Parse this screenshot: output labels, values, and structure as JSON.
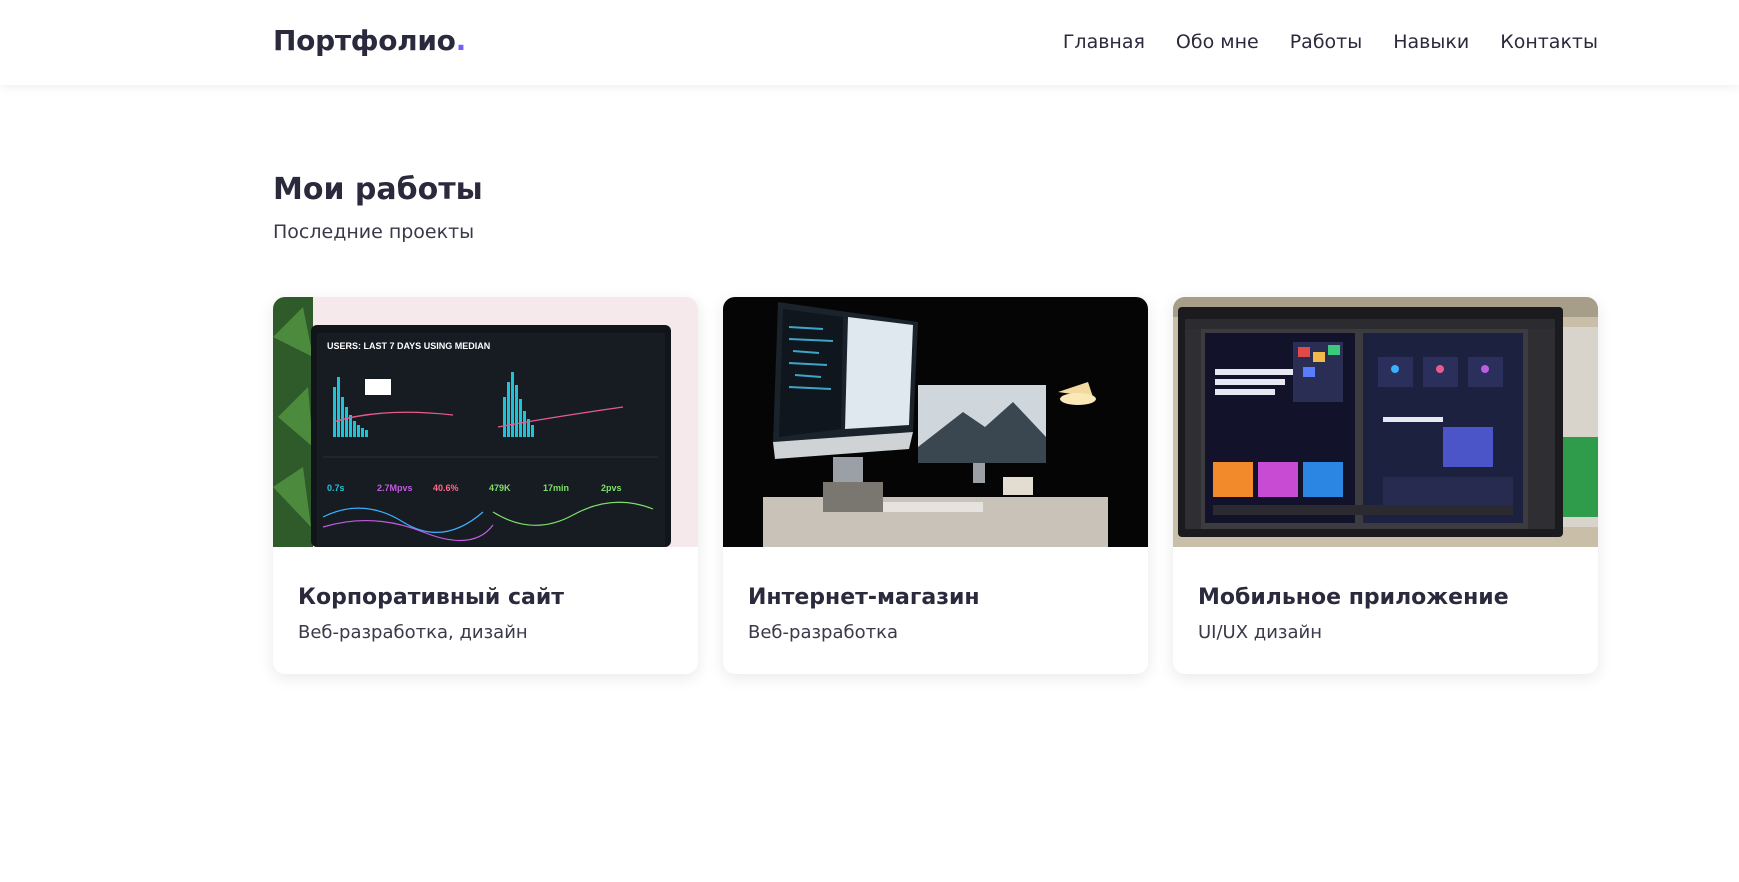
{
  "header": {
    "logo_text": "Портфолио",
    "logo_dot": ".",
    "nav": [
      "Главная",
      "Обо мне",
      "Работы",
      "Навыки",
      "Контакты"
    ]
  },
  "works": {
    "title": "Мои работы",
    "subtitle": "Последние проекты",
    "cards": [
      {
        "title": "Корпоративный сайт",
        "desc": "Веб-разработка, дизайн",
        "image": "analytics-dashboard-laptop"
      },
      {
        "title": "Интернет-магазин",
        "desc": "Веб-разработка",
        "image": "dark-desk-imac-setup"
      },
      {
        "title": "Мобильное приложение",
        "desc": "UI/UX дизайн",
        "image": "design-software-monitor"
      }
    ]
  },
  "colors": {
    "accent": "#6c63ff",
    "text": "#2b2a3d"
  }
}
